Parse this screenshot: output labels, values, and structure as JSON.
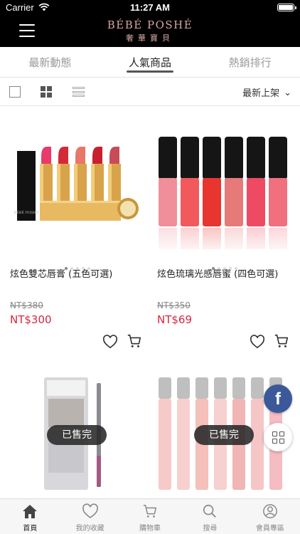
{
  "status": {
    "carrier": "Carrier",
    "time": "11:27 AM"
  },
  "header": {
    "brand": "BÉBÉ POSHÉ",
    "brand_sub": "奢華寶貝"
  },
  "tabs": [
    {
      "label": "最新動態"
    },
    {
      "label": "人氣商品"
    },
    {
      "label": "熱銷排行"
    }
  ],
  "toolbar": {
    "sort_label": "最新上架"
  },
  "products": [
    {
      "name": "炫色雙芯唇膏 (五色可選)",
      "old_price": "NT$380",
      "price": "NT$300",
      "sold_out": ""
    },
    {
      "name": "炫色琉璃光感唇蜜 (四色可選)",
      "old_price": "NT$350",
      "price": "NT$69",
      "sold_out": ""
    },
    {
      "name": "",
      "old_price": "",
      "price": "",
      "sold_out": "已售完"
    },
    {
      "name": "",
      "old_price": "",
      "price": "",
      "sold_out": "已售完"
    }
  ],
  "fab": {
    "facebook": "f"
  },
  "bottom_nav": [
    {
      "label": "首頁",
      "icon": "home-icon"
    },
    {
      "label": "我的收藏",
      "icon": "heart-icon"
    },
    {
      "label": "購物車",
      "icon": "cart-icon"
    },
    {
      "label": "搜尋",
      "icon": "search-icon"
    },
    {
      "label": "會員專區",
      "icon": "user-icon"
    }
  ],
  "colors": {
    "price": "#d7263d",
    "brand": "#d7a7a2",
    "facebook": "#3b5998"
  }
}
